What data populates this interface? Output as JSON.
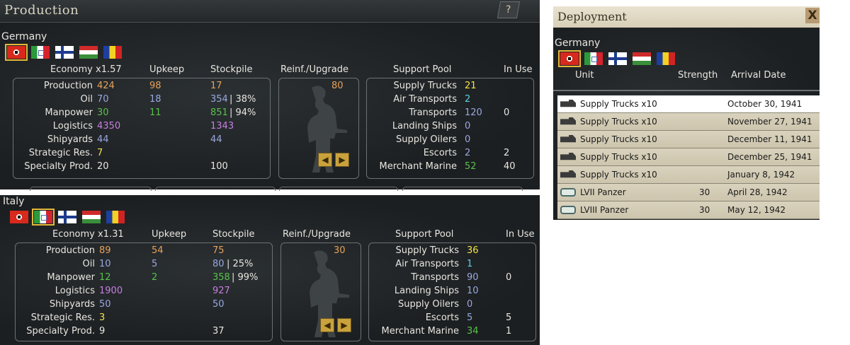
{
  "production": {
    "title": "Production",
    "help_label": "?",
    "germany": {
      "country": "Germany",
      "flags": [
        "germany-flag",
        "italy-flag",
        "finland-flag",
        "hungary-flag",
        "romania-flag"
      ],
      "headers": {
        "economy": "Economy x1.57",
        "upkeep": "Upkeep",
        "stockpile": "Stockpile",
        "reinf": "Reinf./Upgrade",
        "support_pool": "Support Pool",
        "in_use": "In Use"
      },
      "resources": [
        {
          "label": "Production",
          "value": "424",
          "upkeep": "98",
          "stockpile": "17",
          "pct": ""
        },
        {
          "label": "Oil",
          "value": "70",
          "upkeep": "18",
          "stockpile": "354",
          "pct": "| 38%"
        },
        {
          "label": "Manpower",
          "value": "30",
          "upkeep": "11",
          "stockpile": "851",
          "pct": "| 94%"
        },
        {
          "label": "Logistics",
          "value": "4350",
          "upkeep": "",
          "stockpile": "1343",
          "pct": ""
        },
        {
          "label": "Shipyards",
          "value": "44",
          "upkeep": "",
          "stockpile": "44",
          "pct": ""
        },
        {
          "label": "Strategic Res.",
          "value": "7",
          "upkeep": "",
          "stockpile": "",
          "pct": ""
        },
        {
          "label": "Specialty Prod.",
          "value": "20",
          "upkeep": "",
          "stockpile": "100",
          "pct": ""
        }
      ],
      "reinf_value": "80",
      "support": [
        {
          "label": "Supply Trucks",
          "pool": "21",
          "in_use": ""
        },
        {
          "label": "Air Transports",
          "pool": "2",
          "in_use": ""
        },
        {
          "label": "Transports",
          "pool": "120",
          "in_use": "0"
        },
        {
          "label": "Landing Ships",
          "pool": "0",
          "in_use": ""
        },
        {
          "label": "Supply Oilers",
          "pool": "0",
          "in_use": ""
        },
        {
          "label": "Escorts",
          "pool": "2",
          "in_use": "2"
        },
        {
          "label": "Merchant Marine",
          "pool": "52",
          "in_use": "40"
        }
      ]
    },
    "italy": {
      "country": "Italy",
      "headers": {
        "economy": "Economy x1.31",
        "upkeep": "Upkeep",
        "stockpile": "Stockpile",
        "reinf": "Reinf./Upgrade",
        "support_pool": "Support Pool",
        "in_use": "In Use"
      },
      "resources": [
        {
          "label": "Production",
          "value": "89",
          "upkeep": "54",
          "stockpile": "75",
          "pct": ""
        },
        {
          "label": "Oil",
          "value": "10",
          "upkeep": "5",
          "stockpile": "80",
          "pct": "| 25%"
        },
        {
          "label": "Manpower",
          "value": "12",
          "upkeep": "2",
          "stockpile": "358",
          "pct": "| 99%"
        },
        {
          "label": "Logistics",
          "value": "1900",
          "upkeep": "",
          "stockpile": "927",
          "pct": ""
        },
        {
          "label": "Shipyards",
          "value": "50",
          "upkeep": "",
          "stockpile": "50",
          "pct": ""
        },
        {
          "label": "Strategic Res.",
          "value": "3",
          "upkeep": "",
          "stockpile": "",
          "pct": ""
        },
        {
          "label": "Specialty Prod.",
          "value": "9",
          "upkeep": "",
          "stockpile": "37",
          "pct": ""
        }
      ],
      "reinf_value": "30",
      "support": [
        {
          "label": "Supply Trucks",
          "pool": "36",
          "in_use": ""
        },
        {
          "label": "Air Transports",
          "pool": "1",
          "in_use": ""
        },
        {
          "label": "Transports",
          "pool": "90",
          "in_use": "0"
        },
        {
          "label": "Landing Ships",
          "pool": "10",
          "in_use": ""
        },
        {
          "label": "Supply Oilers",
          "pool": "0",
          "in_use": ""
        },
        {
          "label": "Escorts",
          "pool": "5",
          "in_use": "5"
        },
        {
          "label": "Merchant Marine",
          "pool": "34",
          "in_use": "1"
        }
      ]
    }
  },
  "deployment": {
    "title": "Deployment",
    "close_label": "X",
    "country": "Germany",
    "headers": {
      "unit": "Unit",
      "strength": "Strength",
      "arrival": "Arrival Date"
    },
    "rows": [
      {
        "icon": "truck-icon",
        "unit": "Supply Trucks x10",
        "strength": "",
        "date": "October 30, 1941"
      },
      {
        "icon": "truck-icon",
        "unit": "Supply Trucks x10",
        "strength": "",
        "date": "November 27, 1941"
      },
      {
        "icon": "truck-icon",
        "unit": "Supply Trucks x10",
        "strength": "",
        "date": "December 11, 1941"
      },
      {
        "icon": "truck-icon",
        "unit": "Supply Trucks x10",
        "strength": "",
        "date": "December 25, 1941"
      },
      {
        "icon": "truck-icon",
        "unit": "Supply Trucks x10",
        "strength": "",
        "date": "January 8, 1942"
      },
      {
        "icon": "tank-icon",
        "unit": "LVII Panzer",
        "strength": "30",
        "date": "April 28, 1942"
      },
      {
        "icon": "tank-icon",
        "unit": "LVIII Panzer",
        "strength": "30",
        "date": "May 12, 1942"
      }
    ]
  },
  "colors": {
    "resource_orange": "#e6a25a",
    "resource_blue": "#9aa8e0",
    "resource_green": "#58c24a",
    "resource_purple": "#c77fe0",
    "highlight_yellow": "#f2e24a",
    "highlight_cyan": "#5ad2e6",
    "flag_selected": "#e2b83a"
  }
}
